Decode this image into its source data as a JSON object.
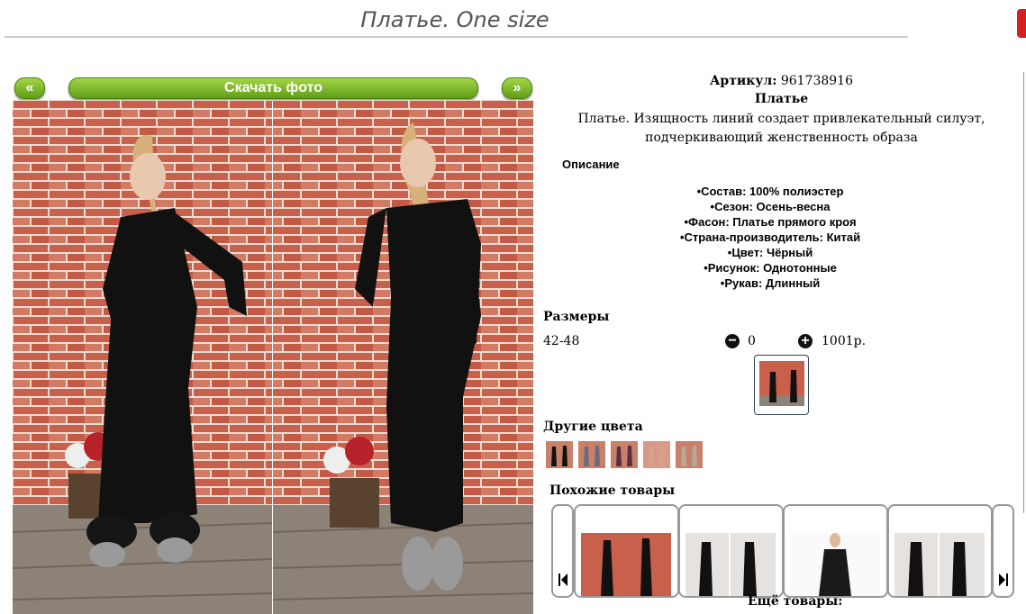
{
  "header": {
    "title": "Платье. One size"
  },
  "gallery": {
    "prev_label": "«",
    "next_label": "»",
    "download_label": "Скачать фото"
  },
  "product": {
    "article_label": "Артикул:",
    "article_value": "961738916",
    "name": "Платье",
    "description": "Платье. Изящность линий создает привлекательный силуэт, подчеркивающий женственность образа",
    "description_heading": "Описание",
    "attributes": [
      "Состав: 100% полиэстер",
      "Сезон: Осень-весна",
      "Фасон: Платье прямого кроя",
      "Страна-производитель: Китай",
      "Цвет: Чёрный",
      "Рисунок: Однотонные",
      "Рукав: Длинный"
    ]
  },
  "sizes": {
    "heading": "Размеры",
    "rows": [
      {
        "label": "42-48",
        "qty": "0",
        "price": "1001р."
      }
    ]
  },
  "other_colors": {
    "heading": "Другие цвета",
    "count": 5
  },
  "similar": {
    "heading": "Похожие товары",
    "more_label": "Ещё товары:"
  },
  "icons": {
    "minus": "minus-circle-icon",
    "plus": "plus-circle-icon",
    "carousel_prev": "skip-back-icon",
    "carousel_next": "skip-forward-icon"
  },
  "colors": {
    "accent_green": "#6fb120",
    "brick": "#c9604b",
    "dress": "#111111"
  }
}
